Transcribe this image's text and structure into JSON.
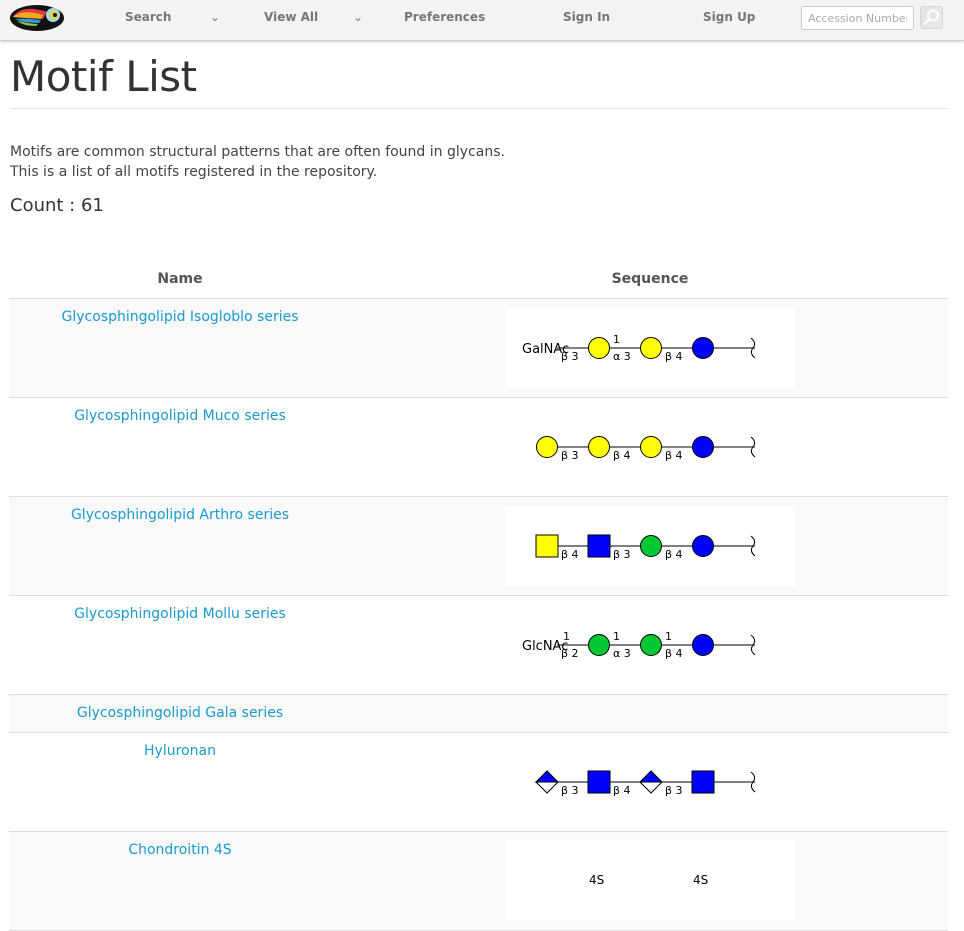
{
  "nav": {
    "search": "Search",
    "view_all": "View All",
    "preferences": "Preferences",
    "sign_in": "Sign In",
    "sign_up": "Sign Up",
    "caret": "⌄",
    "accession_placeholder": "Accession Number",
    "search_icon": "magnifier-icon",
    "logo_icon": "toucan-logo"
  },
  "page": {
    "title": "Motif List",
    "description_line1": "Motifs are common structural patterns that are often found in glycans.",
    "description_line2": "This is a list of all motifs registered in the repository.",
    "count": "Count : 61"
  },
  "table": {
    "headers": {
      "name": "Name",
      "sequence": "Sequence"
    },
    "rows": [
      {
        "name": "Glycosphingolipid Isogloblo series"
      },
      {
        "name": "Glycosphingolipid Muco series"
      },
      {
        "name": "Glycosphingolipid Arthro series"
      },
      {
        "name": "Glycosphingolipid Mollu series"
      },
      {
        "name": "Glycosphingolipid Gala series"
      },
      {
        "name": "Hyluronan"
      },
      {
        "name": "Chondroitin 4S"
      }
    ],
    "glycan_labels": {
      "galnac": "GalNAc",
      "glcnac": "GlcNAc",
      "b3": "β 3",
      "b4": "β 4",
      "b2": "β 2",
      "a3": "α 3",
      "one": "1",
      "sulfate": "4S"
    }
  },
  "colors": {
    "navbar_bg": "#f3f3f3",
    "link": "#1a9ad0",
    "gal_yellow": "#ffff00",
    "glc_blue": "#0000ff",
    "man_green": "#00c832",
    "row_shade": "#f9f9f9"
  }
}
